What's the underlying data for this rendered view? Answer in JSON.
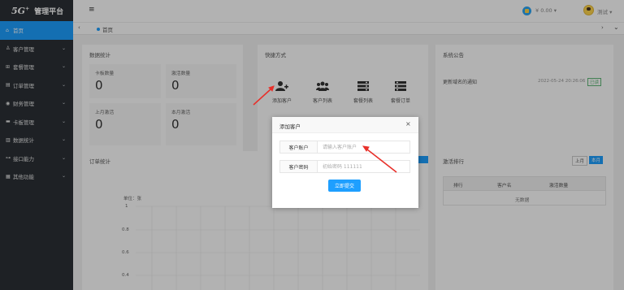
{
  "brand": {
    "mark": "5G",
    "mark_sup": "+",
    "name": "管理平台"
  },
  "sidebar": {
    "items": [
      {
        "label": "首页",
        "icon": "home-icon",
        "glyph": "⌂",
        "active": true
      },
      {
        "label": "客户管理",
        "icon": "user-icon",
        "glyph": "♙"
      },
      {
        "label": "套餐管理",
        "icon": "cart-icon",
        "glyph": "⊞"
      },
      {
        "label": "订单管理",
        "icon": "order-icon",
        "glyph": "▤"
      },
      {
        "label": "财务管理",
        "icon": "finance-icon",
        "glyph": "◉"
      },
      {
        "label": "卡板管理",
        "icon": "card-icon",
        "glyph": "▬"
      },
      {
        "label": "数据统计",
        "icon": "chart-icon",
        "glyph": "▥"
      },
      {
        "label": "接口能力",
        "icon": "plug-icon",
        "glyph": "⊶"
      },
      {
        "label": "其他功能",
        "icon": "grid-icon",
        "glyph": "▦"
      }
    ]
  },
  "header": {
    "menu_icon": "≡",
    "balance": "¥ 0.00",
    "user": "测试"
  },
  "tabs": {
    "home": "首页",
    "prev": "‹",
    "next": "›",
    "more": "⌄"
  },
  "data_stats": {
    "title": "数据统计",
    "items": [
      {
        "label": "卡板数量",
        "value": "0"
      },
      {
        "label": "激活数量",
        "value": "0"
      },
      {
        "label": "上月激活",
        "value": "0"
      },
      {
        "label": "本月激活",
        "value": "0"
      }
    ]
  },
  "quick_actions": {
    "title": "快捷方式",
    "items": [
      {
        "label": "添加客户",
        "icon": "add-user-icon"
      },
      {
        "label": "客户列表",
        "icon": "users-icon"
      },
      {
        "label": "套餐列表",
        "icon": "list-icon"
      },
      {
        "label": "套餐订单",
        "icon": "order-list-icon"
      }
    ]
  },
  "announcement": {
    "title": "系统公告",
    "item_title": "更新域名的通知",
    "item_date": "2022-05-24 20:26:06",
    "item_badge": "已读"
  },
  "order_stats": {
    "title": "订单统计",
    "unit": "单位：张",
    "ticks": [
      "1",
      "0.8",
      "0.6",
      "0.4"
    ]
  },
  "activation_rank": {
    "title": "激活排行",
    "btn_last": "上月",
    "btn_this": "本月",
    "columns": [
      "排行",
      "客户名",
      "激活数量"
    ],
    "empty": "无数据"
  },
  "modal": {
    "title": "添加客户",
    "close": "×",
    "account_label": "客户账户",
    "account_placeholder": "请输入客户账户",
    "password_label": "客户密码",
    "password_placeholder": "初始密码 111111",
    "submit_label": "立即提交"
  },
  "colors": {
    "accent": "#1e9fff",
    "sidebar": "#2b3036",
    "annotation": "#e8302a"
  }
}
